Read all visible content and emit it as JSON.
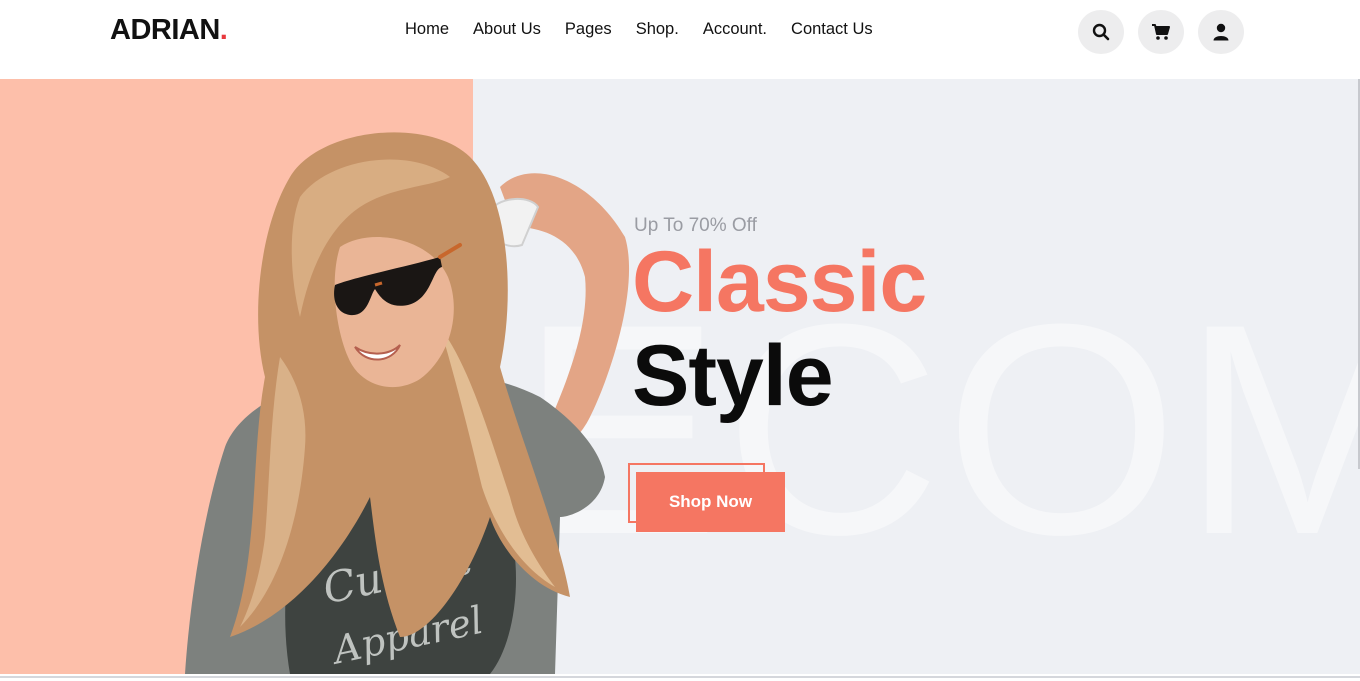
{
  "header": {
    "logo_text": "ADRIAN",
    "logo_dot": ".",
    "nav": [
      {
        "label": "Home"
      },
      {
        "label": "About Us"
      },
      {
        "label": "Pages"
      },
      {
        "label": "Shop."
      },
      {
        "label": "Account."
      },
      {
        "label": "Contact Us"
      }
    ],
    "icons": [
      "search-icon",
      "cart-icon",
      "user-icon"
    ]
  },
  "hero": {
    "subtitle": "Up To 70% Off",
    "title_line1": "Classic",
    "title_line2": "Style",
    "watermark": "ECOM",
    "cta_label": "Shop Now",
    "model_shirt_text_1": "Culprit",
    "model_shirt_text_2": "Apparel"
  },
  "colors": {
    "accent": "#f57662",
    "peach_panel": "#fdbfaa",
    "hero_background": "#eef0f4",
    "logo_dot": "#e8383d"
  }
}
